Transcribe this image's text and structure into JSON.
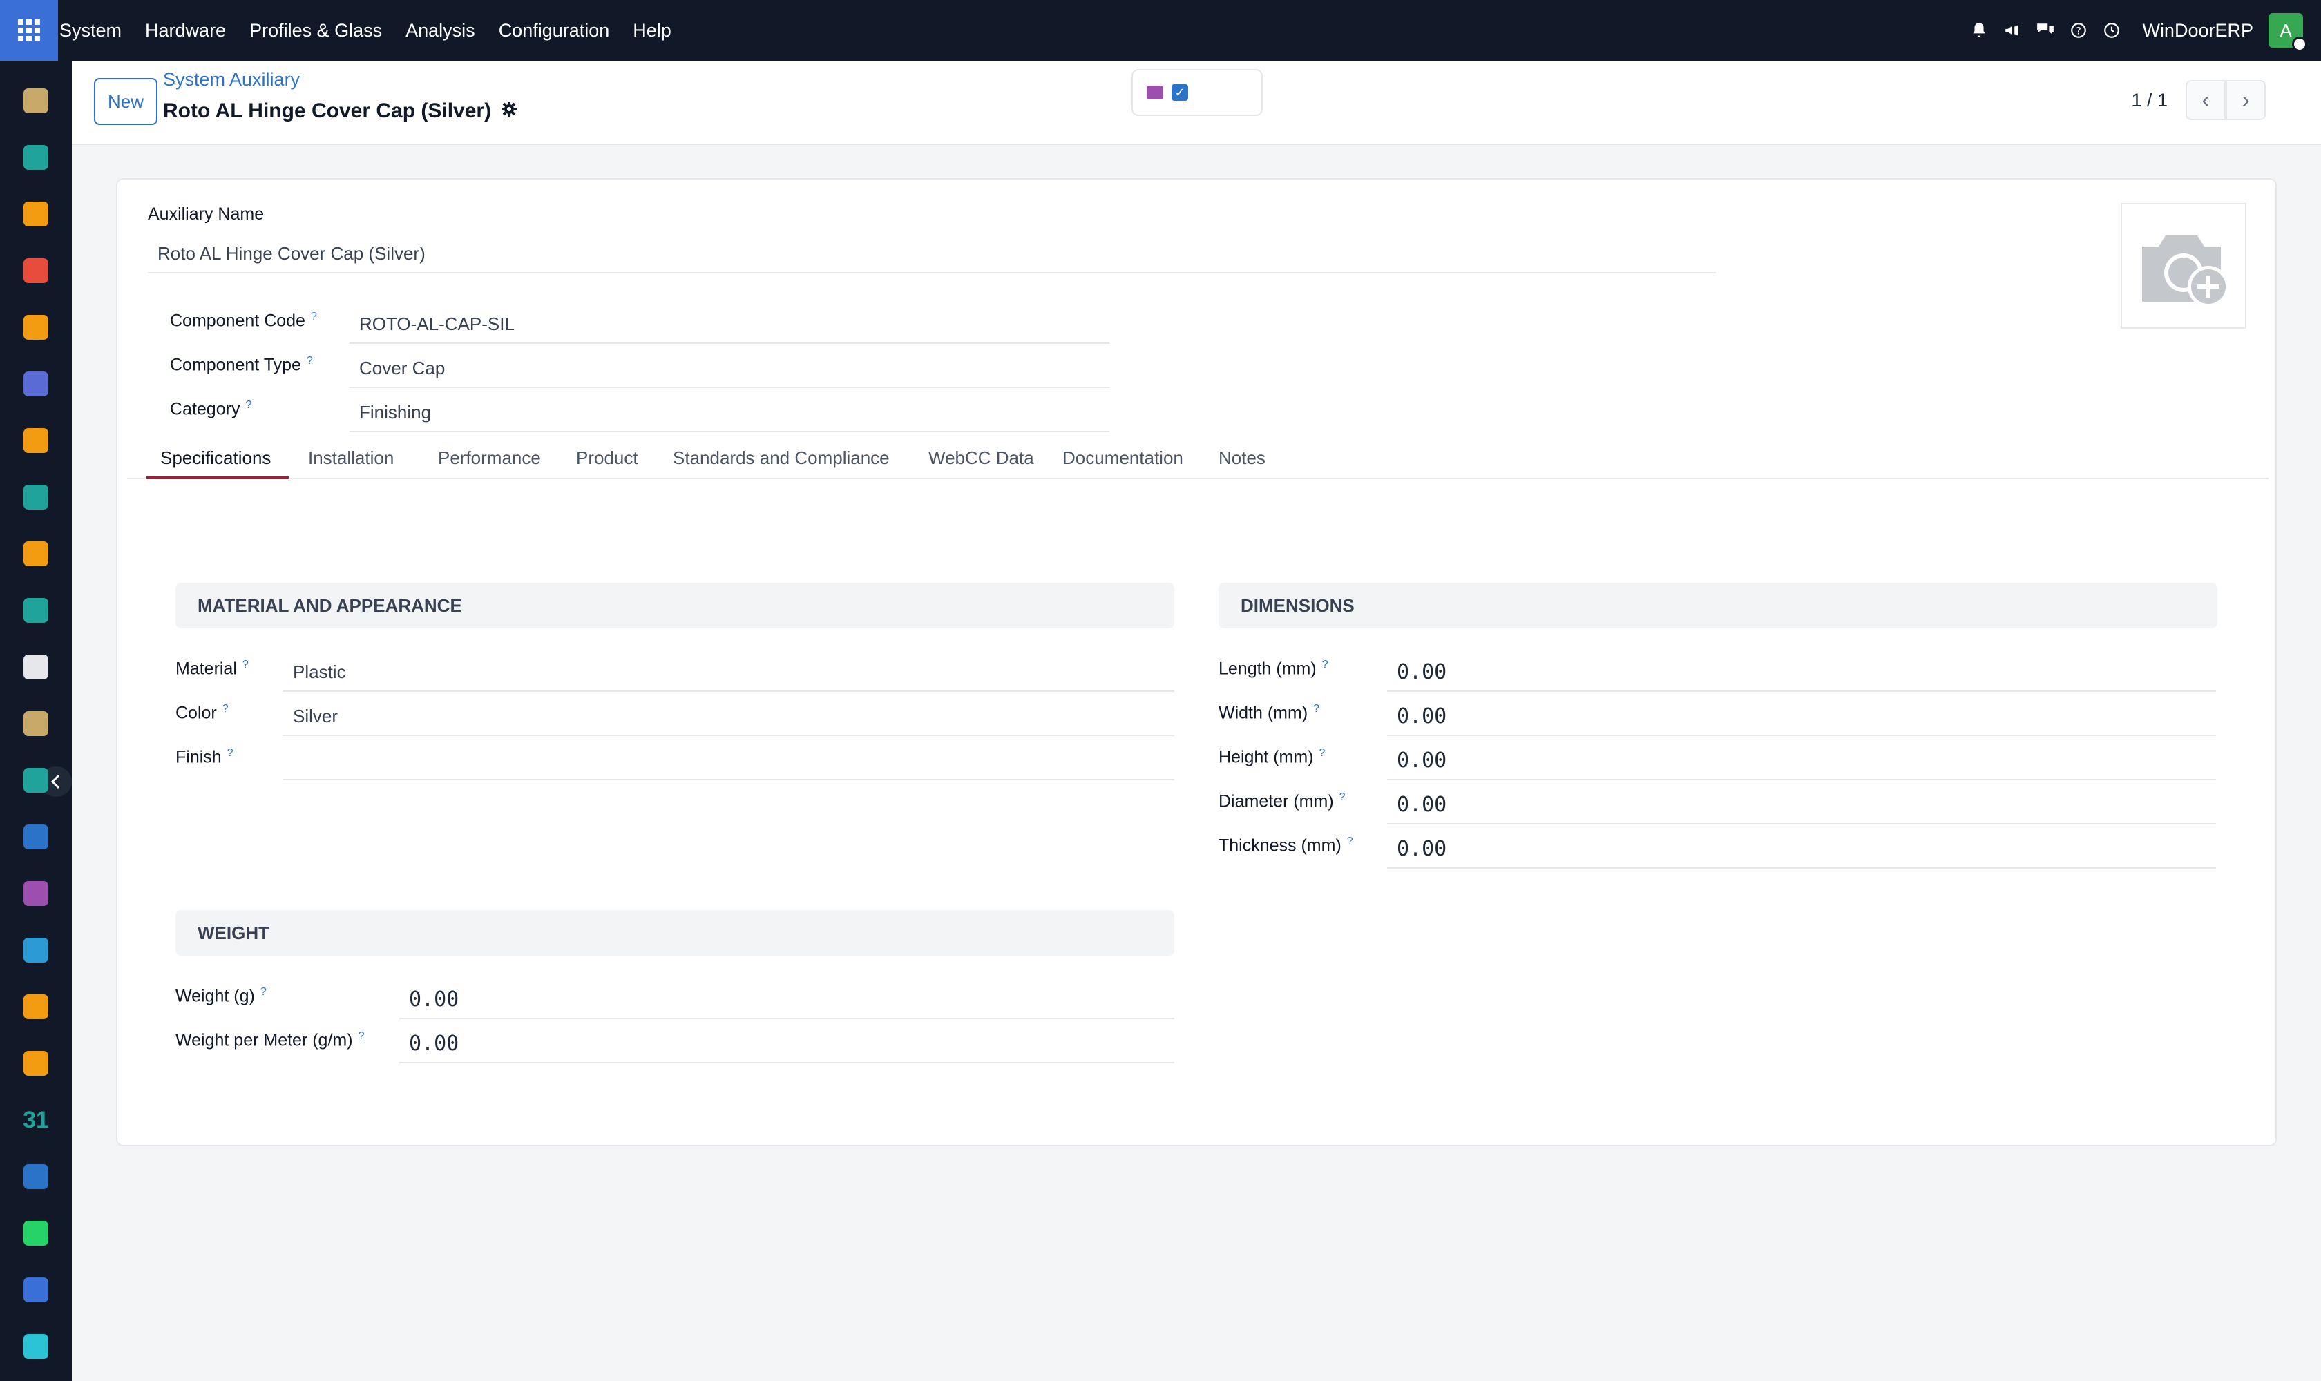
{
  "navbar": {
    "menu": [
      "System",
      "Hardware",
      "Profiles & Glass",
      "Analysis",
      "Configuration",
      "Help"
    ],
    "brand": "WinDoorERP",
    "avatar_initial": "A"
  },
  "sidebar_apps": [
    {
      "name": "app-1",
      "color": "#c9a96a"
    },
    {
      "name": "app-2",
      "color": "#1fa39a"
    },
    {
      "name": "app-3",
      "color": "#f39c12"
    },
    {
      "name": "app-4",
      "color": "#e74c3c"
    },
    {
      "name": "app-5",
      "color": "#f39c12"
    },
    {
      "name": "app-6",
      "color": "#5b6bd6"
    },
    {
      "name": "app-7",
      "color": "#f39c12"
    },
    {
      "name": "app-8",
      "color": "#1fa39a"
    },
    {
      "name": "app-9",
      "color": "#f39c12"
    },
    {
      "name": "app-10",
      "color": "#1fa39a"
    },
    {
      "name": "app-11",
      "color": "#e5e7eb"
    },
    {
      "name": "app-12",
      "color": "#c9a96a"
    },
    {
      "name": "app-13",
      "color": "#1fa39a"
    },
    {
      "name": "app-14",
      "color": "#2b72c9"
    },
    {
      "name": "app-15",
      "color": "#9d4fb0"
    },
    {
      "name": "app-16",
      "color": "#2b9bd6"
    },
    {
      "name": "app-17",
      "color": "#f39c12"
    },
    {
      "name": "app-18",
      "color": "#f39c12"
    },
    {
      "name": "app-19",
      "color": "#1fa39a"
    },
    {
      "name": "app-20",
      "color": "#2b72c9"
    },
    {
      "name": "app-21",
      "color": "#25d366"
    },
    {
      "name": "app-22",
      "color": "#3b6fd8"
    },
    {
      "name": "app-23",
      "color": "#2bc4d6"
    }
  ],
  "sidebar_calendar_label": "31",
  "control": {
    "new_label": "New",
    "breadcrumb": "System Auxiliary",
    "title": "Roto AL Hinge Cover Cap (Silver)",
    "pager": "1 / 1"
  },
  "form": {
    "aux_name_label": "Auxiliary Name",
    "aux_name_value": "Roto AL Hinge Cover Cap (Silver)",
    "component_code_label": "Component Code",
    "component_code_value": "ROTO-AL-CAP-SIL",
    "component_type_label": "Component Type",
    "component_type_value": "Cover Cap",
    "category_label": "Category",
    "category_value": "Finishing"
  },
  "tabs": [
    "Specifications",
    "Installation",
    "Performance",
    "Product",
    "Standards and Compliance",
    "WebCC Data",
    "Documentation",
    "Notes"
  ],
  "material": {
    "header": "MATERIAL AND APPEARANCE",
    "material_label": "Material",
    "material_value": "Plastic",
    "color_label": "Color",
    "color_value": "Silver",
    "finish_label": "Finish",
    "finish_value": ""
  },
  "dimensions": {
    "header": "DIMENSIONS",
    "length_label": "Length (mm)",
    "length_value": "0.00",
    "width_label": "Width (mm)",
    "width_value": "0.00",
    "height_label": "Height (mm)",
    "height_value": "0.00",
    "diameter_label": "Diameter (mm)",
    "diameter_value": "0.00",
    "thickness_label": "Thickness (mm)",
    "thickness_value": "0.00"
  },
  "weight": {
    "header": "WEIGHT",
    "weight_label": "Weight (g)",
    "weight_value": "0.00",
    "wpm_label": "Weight per Meter (g/m)",
    "wpm_value": "0.00"
  },
  "help_mark": "?"
}
